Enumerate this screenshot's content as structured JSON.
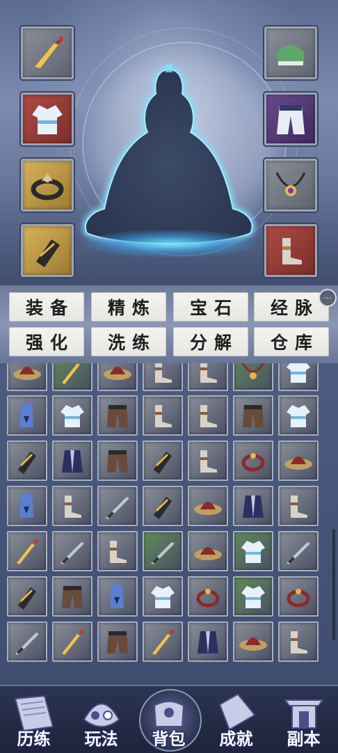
{
  "tabs": [
    {
      "label": "装备"
    },
    {
      "label": "精炼"
    },
    {
      "label": "宝石"
    },
    {
      "label": "经脉"
    },
    {
      "label": "强化"
    },
    {
      "label": "洗练"
    },
    {
      "label": "分解"
    },
    {
      "label": "仓库"
    }
  ],
  "equipment_slots": {
    "left": [
      "dagger-icon",
      "robe-icon",
      "ring-icon",
      "bracer-icon"
    ],
    "right": [
      "shoulder-armor-icon",
      "pants-icon",
      "necklace-icon",
      "boots-icon"
    ]
  },
  "inventory": {
    "rows": [
      [
        "hat-icon",
        "dagger-icon",
        "hat-icon",
        "boots-icon",
        "boots-icon",
        "necklace-icon",
        "robe-icon"
      ],
      [
        "shoulder-icon",
        "robe-icon",
        "pants-icon",
        "boots-icon",
        "boots-icon",
        "pants-icon",
        "robe-icon"
      ],
      [
        "bracer-icon",
        "armor-icon",
        "pants-icon",
        "bracer-icon",
        "boots-icon",
        "ring-icon",
        "hat-icon"
      ],
      [
        "shoulder-icon",
        "boots-icon",
        "sword-icon",
        "bracer-icon",
        "hat-icon",
        "armor-icon",
        "boots-icon"
      ],
      [
        "dagger-icon",
        "sword-icon",
        "boots-icon",
        "sword-icon",
        "hat-icon",
        "robe-icon",
        "sword-icon"
      ],
      [
        "bracer-icon",
        "pants-icon",
        "shoulder-icon",
        "robe-icon",
        "ring-icon",
        "robe-icon",
        "ring-icon"
      ],
      [
        "sword-icon",
        "dagger-icon",
        "pants-icon",
        "dagger-icon",
        "armor-icon",
        "hat-icon",
        "boots-icon"
      ]
    ]
  },
  "bottom_nav": [
    {
      "label": "历练",
      "icon": "scroll-icon"
    },
    {
      "label": "玩法",
      "icon": "cloud-swirl-icon"
    },
    {
      "label": "背包",
      "icon": "bag-icon",
      "active": true
    },
    {
      "label": "成就",
      "icon": "trophy-icon"
    },
    {
      "label": "副本",
      "icon": "gate-icon"
    }
  ],
  "colors": {
    "slot_gold": "#c9a24a",
    "slot_red": "#9b3a34",
    "slot_purple": "#5a3a7a",
    "slot_gray": "#7a7f8a",
    "cell_green": "#5f8a5a",
    "cell_gray": "#8a8f99",
    "glow": "#7fe0ff"
  }
}
